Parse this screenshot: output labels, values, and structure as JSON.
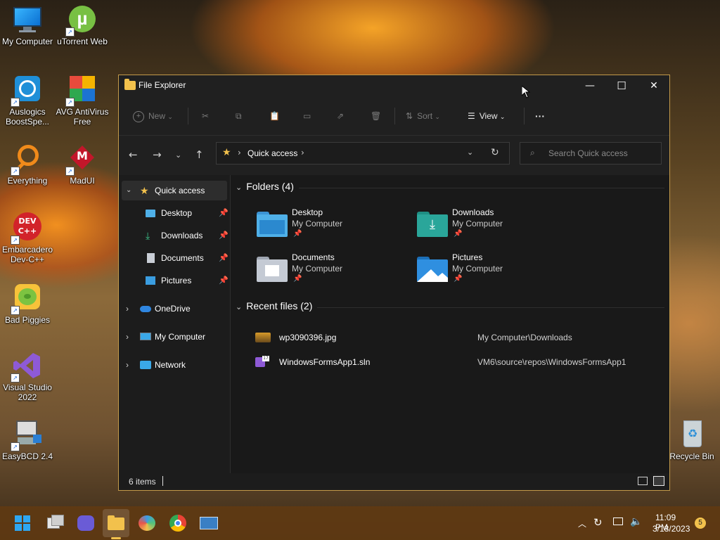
{
  "desktop": {
    "icons": [
      {
        "label": "My Computer"
      },
      {
        "label": "uTorrent Web"
      },
      {
        "label": "Auslogics BoostSpe..."
      },
      {
        "label": "AVG AntiVirus Free"
      },
      {
        "label": "Everything"
      },
      {
        "label": "MadUI"
      },
      {
        "label": "Embarcadero Dev-C++"
      },
      {
        "label": "Bad Piggies"
      },
      {
        "label": "Visual Studio 2022"
      },
      {
        "label": "EasyBCD 2.4"
      },
      {
        "label": "Recycle Bin"
      }
    ]
  },
  "window": {
    "title": "File Explorer",
    "controls": {
      "minimize": "—",
      "maximize": "☐",
      "close": "✕"
    },
    "toolbar": {
      "new_label": "New",
      "sort_label": "Sort",
      "view_label": "View",
      "more_label": "···"
    },
    "address": {
      "crumb": "Quick access"
    },
    "search": {
      "placeholder": "Search Quick access"
    },
    "sidebar": {
      "items": [
        {
          "label": "Quick access"
        },
        {
          "label": "Desktop"
        },
        {
          "label": "Downloads"
        },
        {
          "label": "Documents"
        },
        {
          "label": "Pictures"
        },
        {
          "label": "OneDrive"
        },
        {
          "label": "My Computer"
        },
        {
          "label": "Network"
        }
      ]
    },
    "folders_section": {
      "header": "Folders (4)",
      "items": [
        {
          "name": "Desktop",
          "location": "My Computer"
        },
        {
          "name": "Downloads",
          "location": "My Computer"
        },
        {
          "name": "Documents",
          "location": "My Computer"
        },
        {
          "name": "Pictures",
          "location": "My Computer"
        }
      ]
    },
    "recent_section": {
      "header": "Recent files (2)",
      "items": [
        {
          "name": "wp3090396.jpg",
          "path": "My Computer\\Downloads"
        },
        {
          "name": "WindowsFormsApp1.sln",
          "path": "VM6\\source\\repos\\WindowsFormsApp1"
        }
      ]
    },
    "status": {
      "count": "6 items"
    }
  },
  "taskbar": {
    "clock_time": "11:09 PM",
    "clock_date": "3/18/2023",
    "notification_count": "5"
  },
  "colors": {
    "window_bg": "#191919",
    "chrome_bg": "#202020",
    "folder_blue": "#4fb0e8",
    "folder_teal": "#2aa69a",
    "star_yellow": "#f2c14c",
    "taskbar_bg": "#603a12"
  }
}
